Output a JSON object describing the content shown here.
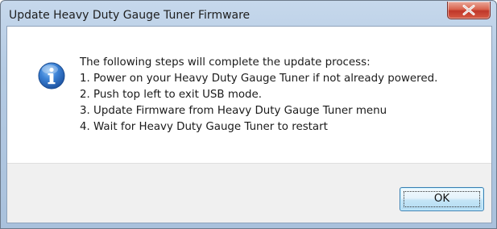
{
  "window": {
    "title": "Update Heavy Duty Gauge Tuner Firmware",
    "close_icon": "close-icon"
  },
  "message": {
    "icon": "info-icon",
    "lines": [
      "The following steps will complete the update process:",
      "1. Power on your Heavy Duty Gauge Tuner if not already powered.",
      "2. Push top left to exit USB mode.",
      "3. Update Firmware from Heavy Duty Gauge Tuner menu",
      "4. Wait for Heavy Duty Gauge Tuner to restart"
    ]
  },
  "buttons": {
    "ok_label": "OK"
  },
  "colors": {
    "titlebar": "#b5cbe3",
    "close_button": "#c0372a",
    "info_icon": "#2b6fc2",
    "ok_border": "#3c7fb1"
  }
}
